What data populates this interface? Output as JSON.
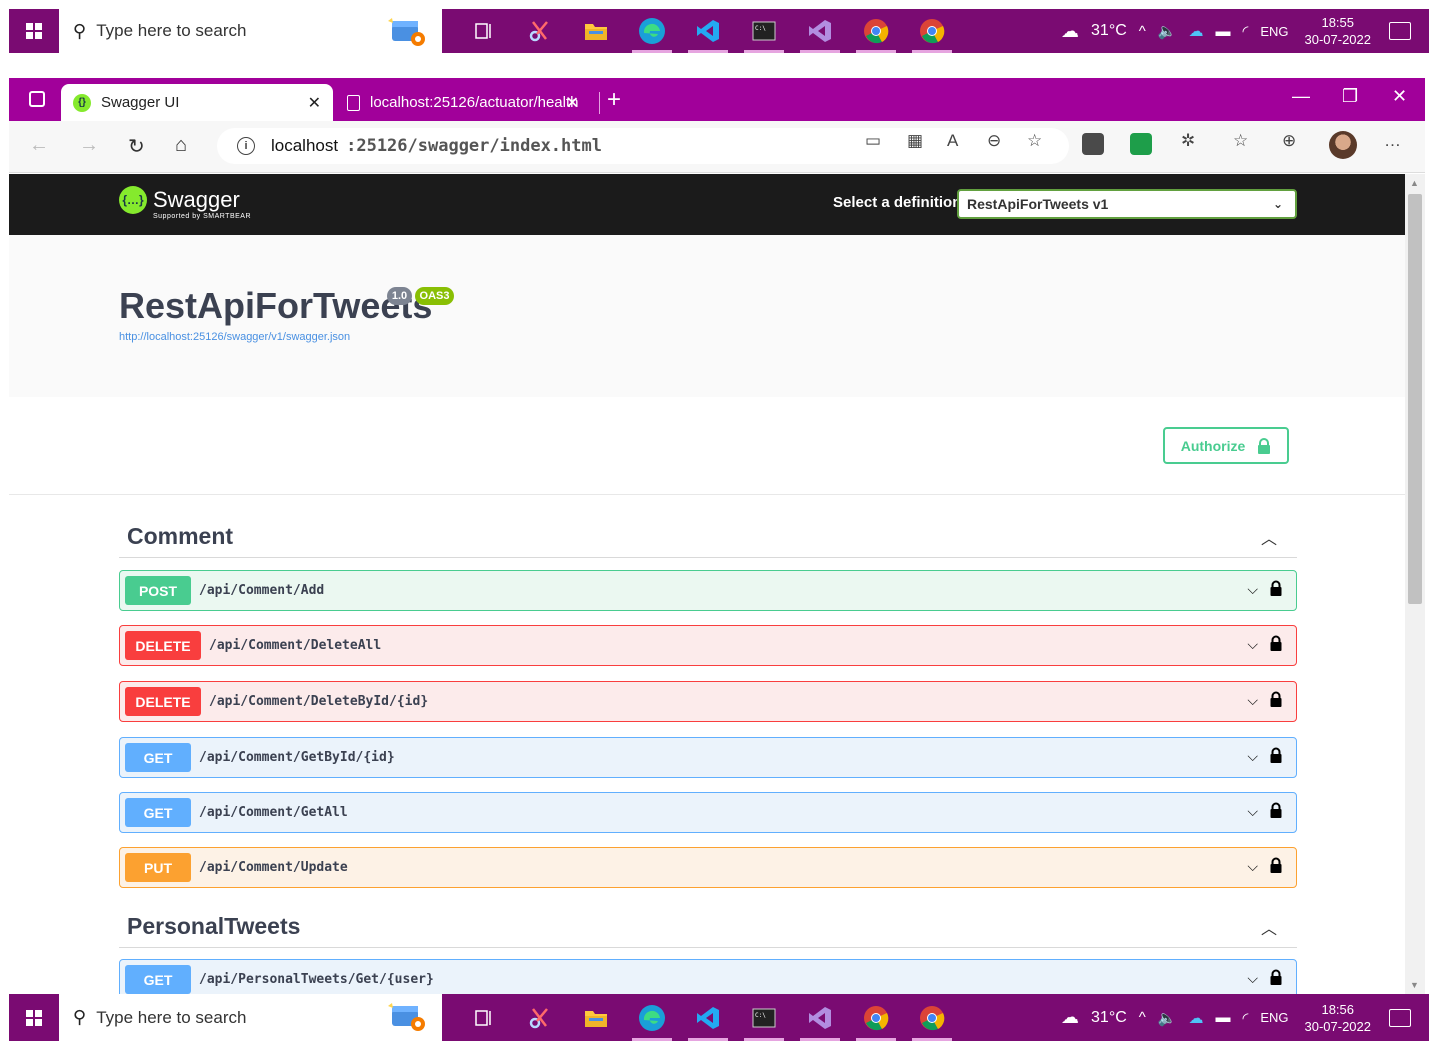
{
  "taskbar": {
    "search_placeholder": "Type here to search",
    "weather": "31°C",
    "lang": "ENG",
    "top_time": "18:55",
    "top_date": "30-07-2022",
    "bottom_time": "18:56",
    "bottom_date": "30-07-2022",
    "accent": "#7a0b72"
  },
  "browser": {
    "tabs": [
      {
        "label": "Swagger UI",
        "active": true
      },
      {
        "label": "localhost:25126/actuator/health",
        "active": false
      }
    ],
    "url_host": "localhost",
    "url_path": ":25126/swagger/index.html"
  },
  "swagger": {
    "logo_text": "Swagger",
    "logo_sub": "Supported by SMARTBEAR",
    "select_label": "Select a definition",
    "select_value": "RestApiForTweets v1",
    "title": "RestApiForTweets",
    "version_badge": "1.0",
    "oas_badge": "OAS3",
    "spec_url": "http://localhost:25126/swagger/v1/swagger.json",
    "authorize_label": "Authorize"
  },
  "tags": [
    {
      "name": "Comment",
      "operations": [
        {
          "method": "POST",
          "path": "/api/Comment/Add"
        },
        {
          "method": "DELETE",
          "path": "/api/Comment/DeleteAll"
        },
        {
          "method": "DELETE",
          "path": "/api/Comment/DeleteById/{id}"
        },
        {
          "method": "GET",
          "path": "/api/Comment/GetById/{id}"
        },
        {
          "method": "GET",
          "path": "/api/Comment/GetAll"
        },
        {
          "method": "PUT",
          "path": "/api/Comment/Update"
        }
      ]
    },
    {
      "name": "PersonalTweets",
      "operations": [
        {
          "method": "GET",
          "path": "/api/PersonalTweets/Get/{user}"
        }
      ]
    }
  ]
}
